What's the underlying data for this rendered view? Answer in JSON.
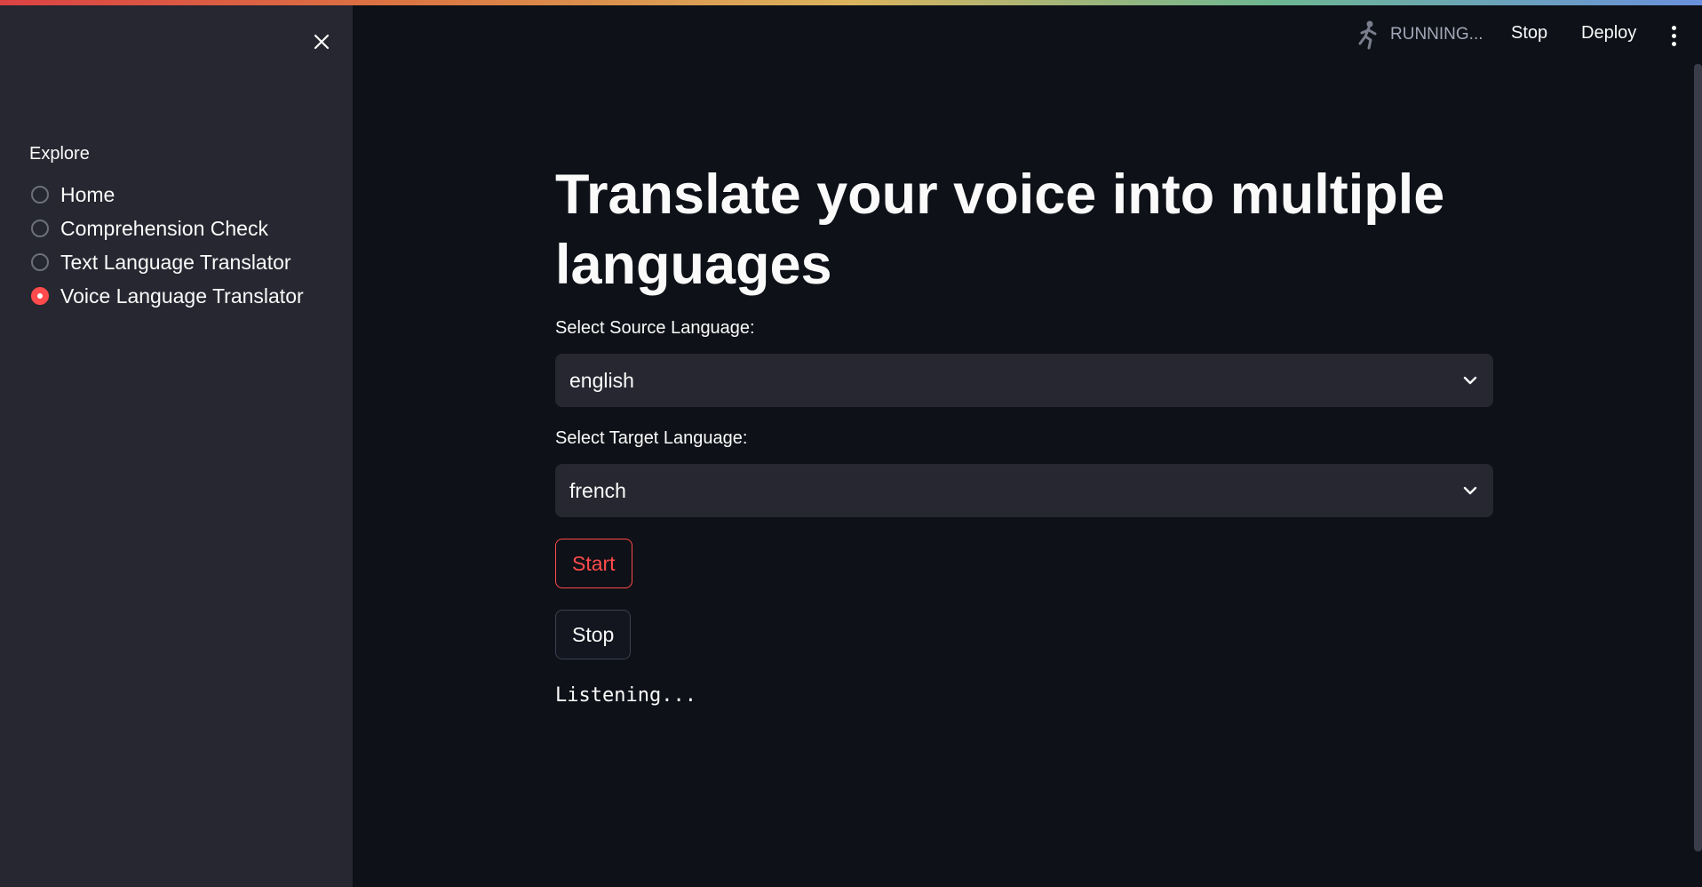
{
  "sidebar": {
    "close_icon": "close-icon",
    "nav_label": "Explore",
    "items": [
      {
        "label": "Home",
        "checked": false
      },
      {
        "label": "Comprehension Check",
        "checked": false
      },
      {
        "label": "Text Language Translator",
        "checked": false
      },
      {
        "label": "Voice Language Translator",
        "checked": true
      }
    ]
  },
  "header": {
    "status_icon": "running-man-icon",
    "status_text": "RUNNING...",
    "stop_label": "Stop",
    "deploy_label": "Deploy",
    "menu_icon": "kebab-menu-icon"
  },
  "main": {
    "title": "Translate your voice into multiple languages",
    "source": {
      "label": "Select Source Language:",
      "value": "english"
    },
    "target": {
      "label": "Select Target Language:",
      "value": "french"
    },
    "start_label": "Start",
    "stop_label": "Stop",
    "status_text": "Listening..."
  },
  "colors": {
    "background": "#0e1117",
    "sidebar": "#262730",
    "accent": "#ff4b4b",
    "text": "#fafafa"
  }
}
